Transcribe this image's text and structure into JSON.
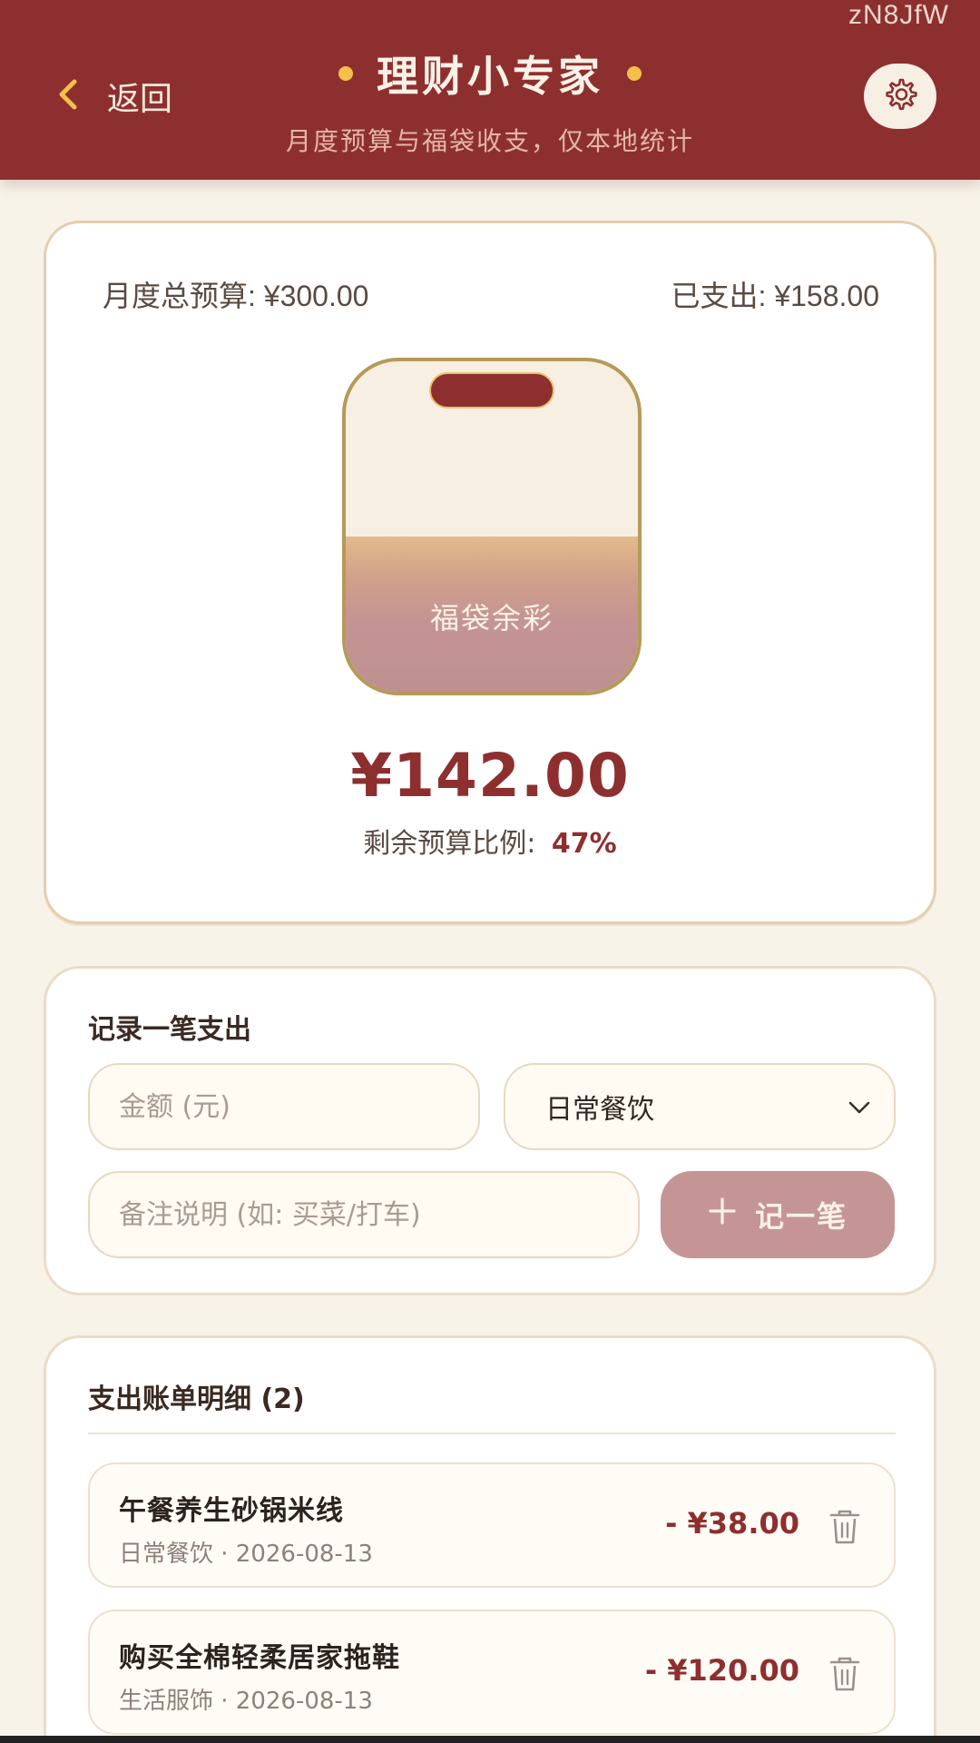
{
  "header": {
    "watermark": "zN8JfW",
    "back_label": "返回",
    "title": "理财小专家",
    "subtitle": "月度预算与福袋收支，仅本地统计"
  },
  "budget": {
    "total_label": "月度总预算: ¥300.00",
    "spent_label": "已支出: ¥158.00",
    "bag_label": "福袋余彩",
    "remaining_amount": "¥142.00",
    "ratio_label": "剩余预算比例:",
    "ratio_value": "47%",
    "remaining_fraction": 0.47
  },
  "record": {
    "title": "记录一笔支出",
    "amount_placeholder": "金额 (元)",
    "category_value": "日常餐饮",
    "note_placeholder": "备注说明 (如: 买菜/打车)",
    "add_label": "记一笔"
  },
  "bills": {
    "title": "支出账单明细 (2)",
    "items": [
      {
        "name": "午餐养生砂锅米线",
        "meta": "日常餐饮 · 2026-08-13",
        "amount": "- ¥38.00"
      },
      {
        "name": "购买全棉轻柔居家拖鞋",
        "meta": "生活服饰 · 2026-08-13",
        "amount": "- ¥120.00"
      }
    ]
  },
  "colors": {
    "header_bg": "#8e2f2f",
    "accent_gold": "#f3c04a",
    "button_pink": "#c59595"
  }
}
